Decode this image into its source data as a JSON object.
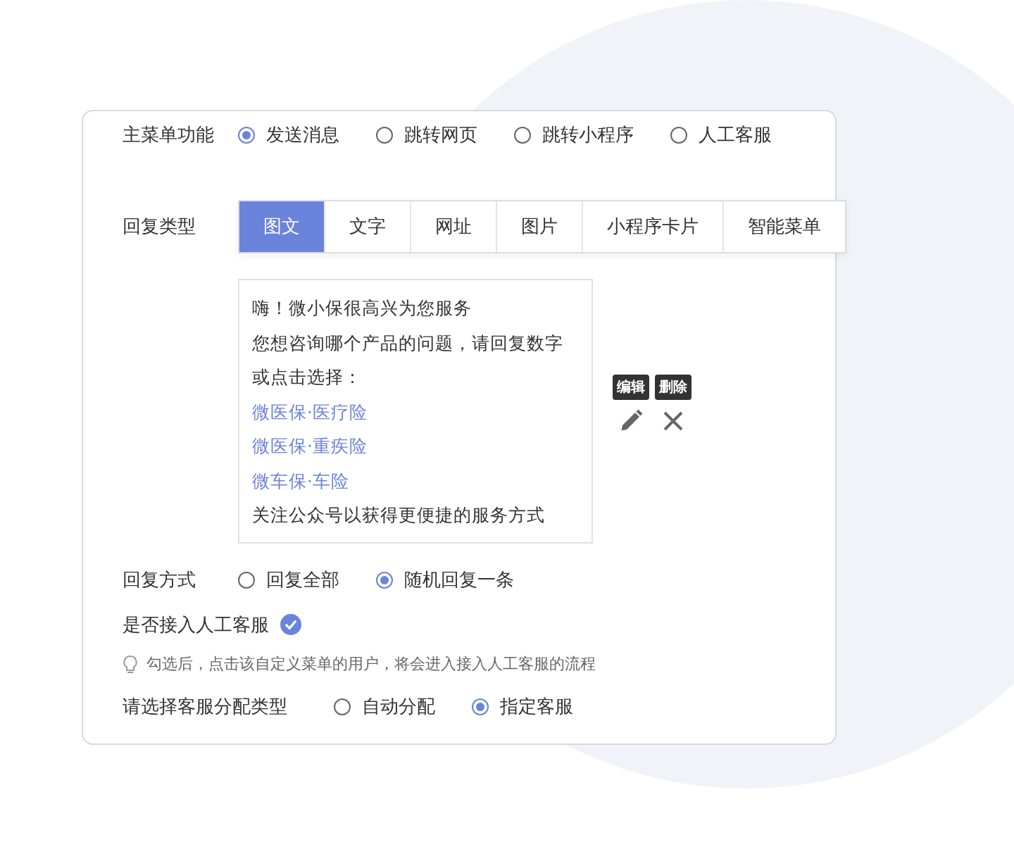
{
  "menu_function": {
    "label": "主菜单功能",
    "options": [
      {
        "label": "发送消息",
        "selected": true
      },
      {
        "label": "跳转网页",
        "selected": false
      },
      {
        "label": "跳转小程序",
        "selected": false
      },
      {
        "label": "人工客服",
        "selected": false
      }
    ]
  },
  "reply_type": {
    "label": "回复类型",
    "tabs": [
      {
        "label": "图文",
        "selected": true
      },
      {
        "label": "文字",
        "selected": false
      },
      {
        "label": "网址",
        "selected": false
      },
      {
        "label": "图片",
        "selected": false
      },
      {
        "label": "小程序卡片",
        "selected": false
      },
      {
        "label": "智能菜单",
        "selected": false
      }
    ]
  },
  "message": {
    "lines": [
      {
        "kind": "text",
        "text": "嗨！微小保很高兴为您服务"
      },
      {
        "kind": "text",
        "text": "您想咨询哪个产品的问题，请回复数字"
      },
      {
        "kind": "text",
        "text": "或点击选择："
      },
      {
        "kind": "link",
        "text": "微医保·医疗险"
      },
      {
        "kind": "link",
        "text": "微医保·重疾险"
      },
      {
        "kind": "link",
        "text": "微车保·车险"
      },
      {
        "kind": "text",
        "text": "关注公众号以获得更便捷的服务方式"
      }
    ],
    "actions": [
      {
        "kind": "edit",
        "tooltip": "编辑"
      },
      {
        "kind": "delete",
        "tooltip": "删除"
      }
    ]
  },
  "reply_mode": {
    "label": "回复方式",
    "options": [
      {
        "label": "回复全部",
        "selected": false
      },
      {
        "label": "随机回复一条",
        "selected": true
      }
    ]
  },
  "manual_service": {
    "label": "是否接入人工客服",
    "checked": true,
    "hint": "勾选后，点击该自定义菜单的用户，将会进入接入人工客服的流程"
  },
  "assign_type": {
    "label": "请选择客服分配类型",
    "options": [
      {
        "label": "自动分配",
        "selected": false
      },
      {
        "label": "指定客服",
        "selected": true
      }
    ]
  }
}
